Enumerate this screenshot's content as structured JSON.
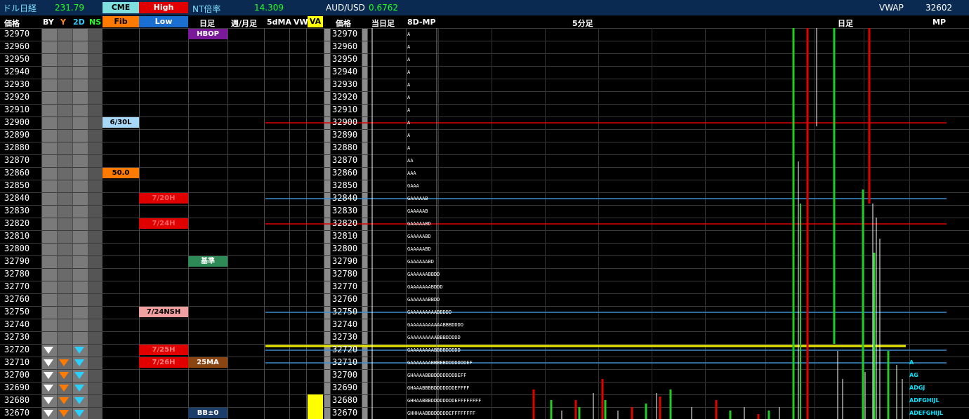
{
  "header": {
    "title": "ドル日経",
    "dollar_nikkei_value": "231.79",
    "cme_label": "CME",
    "high_label": "High",
    "nt_label": "NT倍率",
    "nt_value": "14.309",
    "audusd_label": "AUD/USD",
    "audusd_value": "0.6762",
    "vwap_label": "VWAP",
    "vwap_value": "32602"
  },
  "subheader": {
    "price_label_left": "価格",
    "by_label": "BY",
    "y_label": "Y",
    "twod_label": "2D",
    "ns_label": "NS",
    "fib_label": "Fib",
    "low_label": "Low",
    "daily_label": "日足",
    "weekly_monthly_label": "週/月足",
    "fivedma_label": "5dMA",
    "vw_label": "VW",
    "va_label": "VA",
    "price_label_right": "価格",
    "today_label": "当日足",
    "mp8d_label": "8D-MP",
    "fivemin_label": "5分足",
    "daily_right_label": "日足",
    "mp_label": "MP"
  },
  "prices": [
    "32970",
    "32960",
    "32950",
    "32940",
    "32930",
    "32920",
    "32910",
    "32900",
    "32890",
    "32880",
    "32870",
    "32860",
    "32850",
    "32840",
    "32830",
    "32820",
    "32810",
    "32800",
    "32790",
    "32780",
    "32770",
    "32760",
    "32750",
    "32740",
    "32730",
    "32720",
    "32710",
    "32700",
    "32690",
    "32680",
    "32670"
  ],
  "level_labels": {
    "hbop": "HBOP",
    "l_630": "6/30L",
    "fib_50": "50.0",
    "h_720": "7/20H",
    "h_724": "7/24H",
    "kijun": "基準",
    "nsh_724": "7/24NSH",
    "h_725": "7/25H",
    "h_726": "7/26H",
    "ma25": "25MA",
    "bb0": "BB±0"
  },
  "tpo_rows": [
    "A",
    "A",
    "A",
    "A",
    "A",
    "A",
    "A",
    "A",
    "A",
    "A",
    "AA",
    "AAA",
    "GAAA",
    "GAAAAAB",
    "GAAAAAB",
    "GAAAAABD",
    "GAAAAABD",
    "GAAAAABD",
    "GAAAAAABD",
    "GAAAAAABBDD",
    "GAAAAAAABDDD",
    "GAAAAAABBDD",
    "GAAAAAAAAABBDDD",
    "GAAAAAAAAAAABBBDDDD",
    "GAAAAAAAAABBBDDDDD",
    "GAAAAAAAABBBBDDDDD",
    "GAAAAAAABBBBBDDDDDDDEF",
    "GHAAAABBBDDDDDDDDEFF",
    "GHAAABBBBDDDDDDDEFFFF",
    "GHHAABBBDDDDDDDDEFFFFFFFF",
    "GHHHAABBBDDDDDEFFFFFFFF"
  ],
  "mp_letters": [
    "A",
    "AG",
    "ADGJ",
    "ADFGHIJL",
    "ADEFGHIJL"
  ],
  "colors": {
    "header_bg": "#0a2a52",
    "cme": "#7fe0e0",
    "high": "#e00000",
    "fib": "#ff7a00",
    "low": "#1a6fd1",
    "hbop": "#7a1a9a",
    "kijun": "#2e8b57",
    "ma25": "#8b4513",
    "bb": "#1a3d6a",
    "va": "#ffff00",
    "red_level": "#e00000",
    "blue_level": "#3a8fd0",
    "yellow_level": "#e8e800",
    "up_candle": "#22cc22",
    "down_candle": "#e00000"
  }
}
